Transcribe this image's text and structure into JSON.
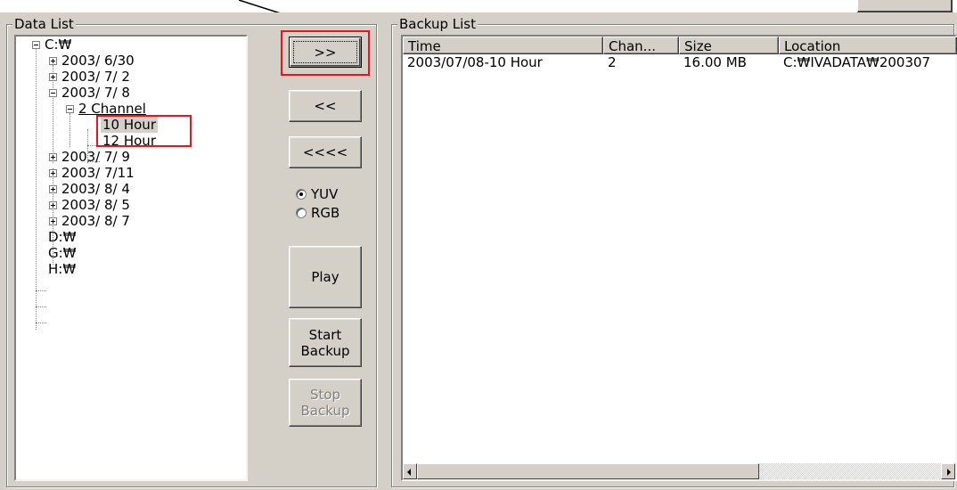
{
  "data_list": {
    "title": "Data List",
    "tree": [
      {
        "label": "C:₩",
        "expander": "minus"
      },
      {
        "label": "2003/ 6/30",
        "expander": "plus"
      },
      {
        "label": "2003/ 7/ 2",
        "expander": "plus"
      },
      {
        "label": "2003/ 7/ 8",
        "expander": "minus"
      },
      {
        "label": "2 Channel",
        "expander": "minus"
      },
      {
        "label": "10 Hour",
        "selected": true
      },
      {
        "label": "12 Hour"
      },
      {
        "label": "2003/ 7/ 9",
        "expander": "plus"
      },
      {
        "label": "2003/ 7/11",
        "expander": "plus"
      },
      {
        "label": "2003/ 8/ 4",
        "expander": "plus"
      },
      {
        "label": "2003/ 8/ 5",
        "expander": "plus"
      },
      {
        "label": "2003/ 8/ 7",
        "expander": "plus"
      },
      {
        "label": "D:₩"
      },
      {
        "label": "G:₩"
      },
      {
        "label": "H:₩"
      }
    ]
  },
  "controls": {
    "add_label": ">>",
    "remove_label": "<<",
    "remove_all_label": "<<<<",
    "format_options": [
      {
        "label": "YUV",
        "selected": true
      },
      {
        "label": "RGB",
        "selected": false
      }
    ],
    "play_label": "Play",
    "start_backup_label": "Start Backup",
    "stop_backup_label": "Stop Backup"
  },
  "backup_list": {
    "title": "Backup List",
    "columns": [
      "Time",
      "Chan...",
      "Size",
      "Location"
    ],
    "rows": [
      [
        "2003/07/08-10 Hour",
        "2",
        "16.00 MB",
        "C:₩IVADATA₩200307"
      ]
    ]
  },
  "colors": {
    "dialog_face": "#d4d0c8",
    "highlight_box": "#e8141e"
  }
}
